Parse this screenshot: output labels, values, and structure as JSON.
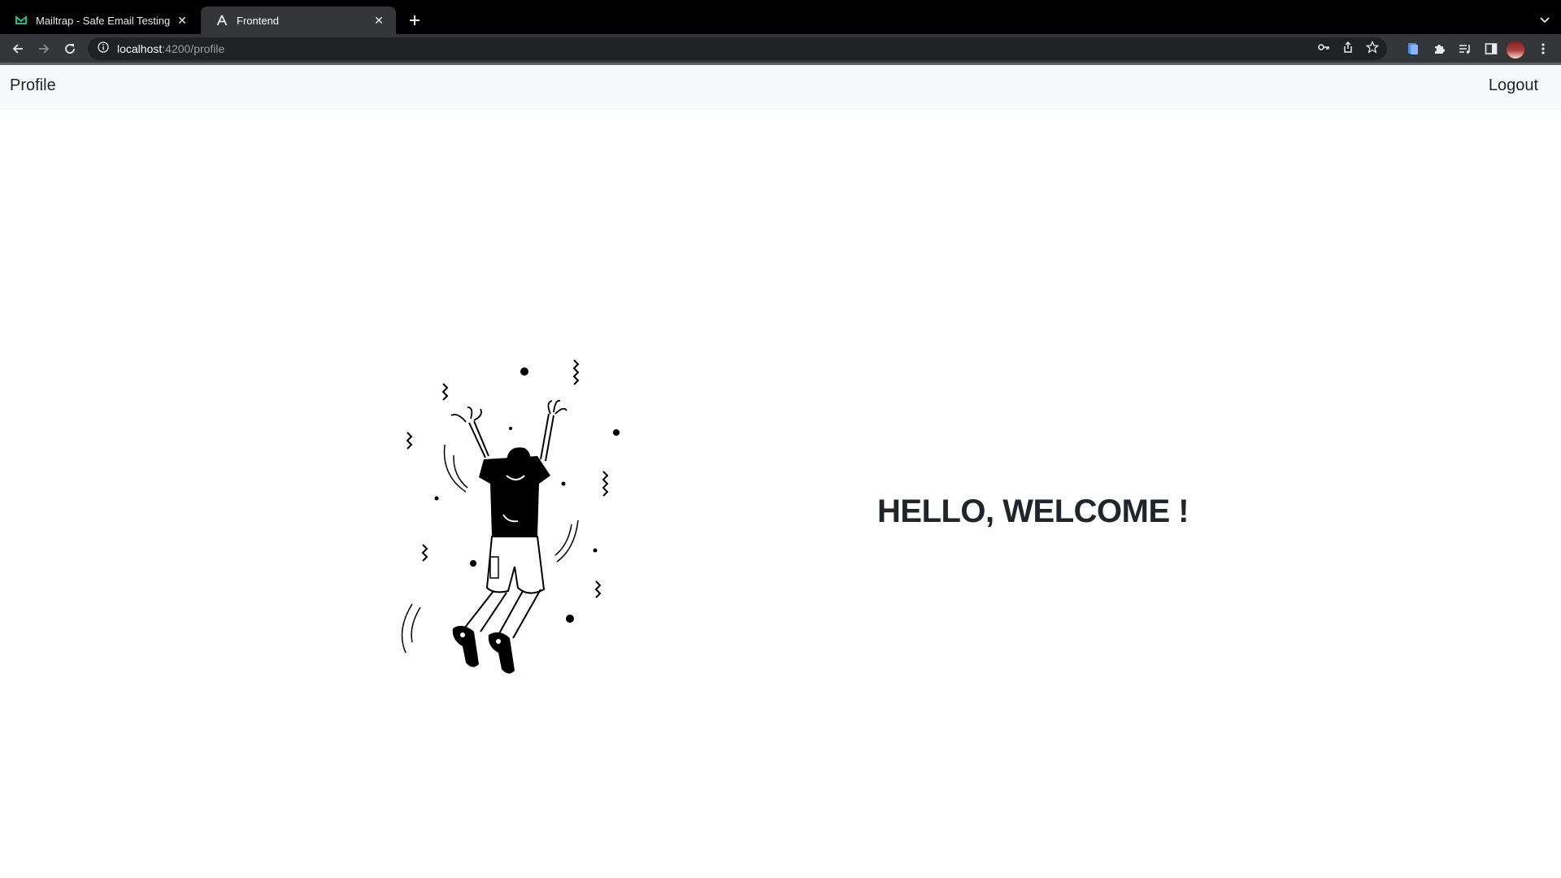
{
  "browser": {
    "tabs": [
      {
        "title": "Mailtrap - Safe Email Testing",
        "icon": "mailtrap-icon",
        "active": false
      },
      {
        "title": "Frontend",
        "icon": "angular-icon",
        "active": true
      }
    ],
    "address": {
      "host": "localhost",
      "path": ":4200/profile"
    }
  },
  "navbar": {
    "brand": "Profile",
    "logout": "Logout"
  },
  "main": {
    "heading": "HELLO, WELCOME !",
    "illustration": "jumping-person-illustration"
  },
  "colors": {
    "navbar_bg": "#f8f9fa",
    "text": "#212529",
    "browser_chrome": "#35363a",
    "tab_strip": "#000000"
  }
}
